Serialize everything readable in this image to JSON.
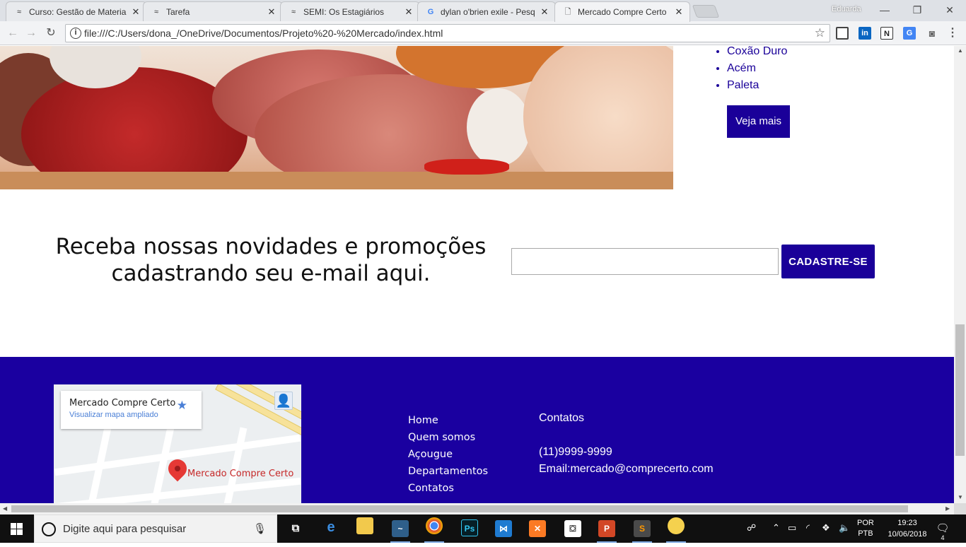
{
  "browser": {
    "tabs": [
      {
        "label": "Curso: Gestão de Materia",
        "icon": "moodle-icon"
      },
      {
        "label": "Tarefa",
        "icon": "moodle-icon"
      },
      {
        "label": "SEMI: Os Estagiários",
        "icon": "moodle-icon"
      },
      {
        "label": "dylan o'brien exile - Pesq",
        "icon": "google-icon"
      },
      {
        "label": "Mercado Compre Certo",
        "icon": "page-icon"
      }
    ],
    "active_tab_index": 4,
    "profile_name": "Eduarda",
    "url": "file:///C:/Users/dona_/OneDrive/Documentos/Projeto%20-%20Mercado/index.html"
  },
  "page": {
    "cuts": [
      "Coxão Duro",
      "Acém",
      "Paleta"
    ],
    "see_more_label": "Veja mais",
    "newsletter_line1": "Receba nossas novidades e promoções",
    "newsletter_line2": "cadastrando seu e-mail aqui.",
    "email_value": "",
    "signup_label": "CADASTRE-SE",
    "map": {
      "title": "Mercado Compre Certo",
      "link": "Visualizar mapa ampliado",
      "pin_label": "Mercado Compre Certo"
    },
    "footer_nav": [
      "Home",
      "Quem somos",
      "Açougue",
      "Departamentos",
      "Contatos"
    ],
    "contacts_title": "Contatos",
    "phone": "(11)9999-9999",
    "email": "Email:mercado@comprecerto.com",
    "brand_color": "#1a00a0"
  },
  "taskbar": {
    "search_placeholder": "Digite aqui para pesquisar",
    "lang_top": "POR",
    "lang_bottom": "PTB",
    "time": "19:23",
    "date": "10/06/2018",
    "notification_count": "4"
  }
}
